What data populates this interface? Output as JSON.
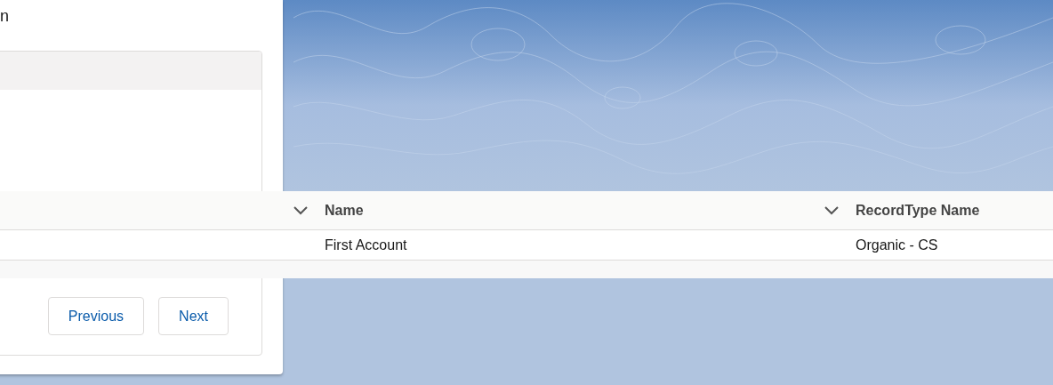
{
  "modal": {
    "title": "n",
    "buttons": [
      "Previous",
      "Next"
    ]
  },
  "table": {
    "columns": [
      {
        "label": "Name"
      },
      {
        "label": "RecordType Name"
      }
    ],
    "rows": [
      [
        "First Account",
        "Organic - CS"
      ]
    ]
  }
}
